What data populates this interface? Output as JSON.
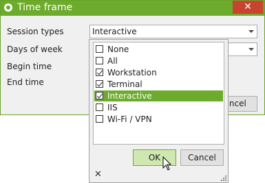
{
  "window": {
    "title": "Time frame",
    "close_glyph": "✕",
    "colors": {
      "accent": "#6cab2b",
      "close": "#c9442f"
    }
  },
  "form": {
    "session_types_label": "Session types",
    "days_label": "Days of week",
    "begin_label": "Begin time",
    "end_label": "End time",
    "session_types_value": "Interactive",
    "days_value": "",
    "cancel_label": "Cancel",
    "cancel_visible_text": "ncel"
  },
  "dropdown": {
    "options": [
      {
        "label": "None",
        "checked": false,
        "selected": false
      },
      {
        "label": "All",
        "checked": false,
        "selected": false
      },
      {
        "label": "Workstation",
        "checked": true,
        "selected": false
      },
      {
        "label": "Terminal",
        "checked": true,
        "selected": false
      },
      {
        "label": "Interactive",
        "checked": true,
        "selected": true
      },
      {
        "label": "IIS",
        "checked": false,
        "selected": false
      },
      {
        "label": "Wi-Fi / VPN",
        "checked": false,
        "selected": false
      }
    ],
    "ok_label": "OK",
    "cancel_label": "Cancel",
    "close_glyph": "✕"
  }
}
